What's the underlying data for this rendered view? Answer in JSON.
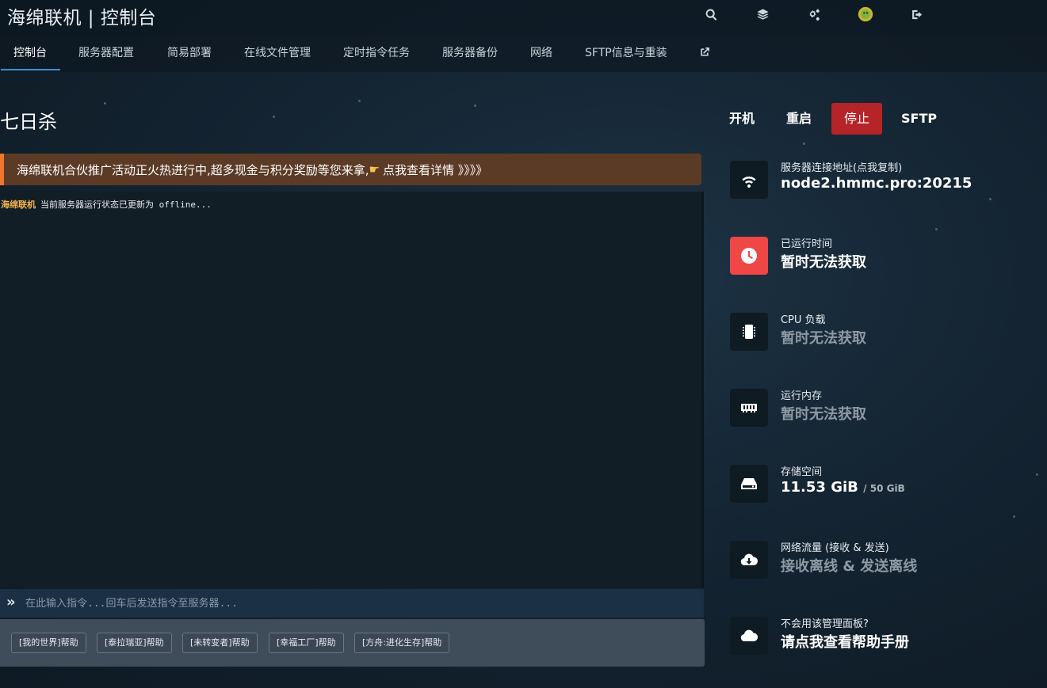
{
  "header": {
    "title": "海绵联机 | 控制台",
    "icons": [
      "search-icon",
      "layers-icon",
      "settings-icon",
      "avatar-icon",
      "logout-icon"
    ]
  },
  "nav": {
    "items": [
      {
        "label": "控制台",
        "active": true
      },
      {
        "label": "服务器配置"
      },
      {
        "label": "简易部署"
      },
      {
        "label": "在线文件管理"
      },
      {
        "label": "定时指令任务"
      },
      {
        "label": "服务器备份"
      },
      {
        "label": "网络"
      },
      {
        "label": "SFTP信息与重装"
      }
    ],
    "external_icon": "external-link-icon"
  },
  "server": {
    "name": "七日杀"
  },
  "power": {
    "start": "开机",
    "restart": "重启",
    "stop": "停止",
    "sftp": "SFTP"
  },
  "promo": {
    "text": "海绵联机合伙推广活动正火热进行中,超多现金与积分奖励等您来拿,",
    "link": "点我查看详情 》》》》",
    "icon": "pointing-hand-icon",
    "accent": "#f0762c"
  },
  "console": {
    "prefix": "海绵联机",
    "line": "当前服务器运行状态已更新为 offline..."
  },
  "command": {
    "prompt": "»",
    "placeholder": "在此输入指令...回车后发送指令至服务器..."
  },
  "help_buttons": [
    "[我的世界]帮助",
    "[泰拉瑞亚]帮助",
    "[未转变者]帮助",
    "[幸福工厂]帮助",
    "[方舟:进化生存]帮助"
  ],
  "stats": {
    "address": {
      "label": "服务器连接地址(点我复制)",
      "value": "node2.hmmc.pro:20215",
      "icon": "wifi-icon"
    },
    "uptime": {
      "label": "已运行时间",
      "value": "暂时无法获取",
      "icon": "clock-icon",
      "color": "#ef4646"
    },
    "cpu": {
      "label": "CPU 负载",
      "value": "暂时无法获取",
      "icon": "cpu-icon"
    },
    "memory": {
      "label": "运行内存",
      "value": "暂时无法获取",
      "icon": "memory-icon"
    },
    "storage": {
      "label": "存储空间",
      "value": "11.53 GiB",
      "total": "/ 50 GiB",
      "icon": "hdd-icon"
    },
    "network": {
      "label": "网络流量 (接收 & 发送)",
      "value": "接收离线 & 发送离线",
      "icon": "cloud-download-icon"
    },
    "help": {
      "label": "不会用该管理面板?",
      "value": "请点我查看帮助手册",
      "icon": "cloud-upload-icon"
    }
  }
}
